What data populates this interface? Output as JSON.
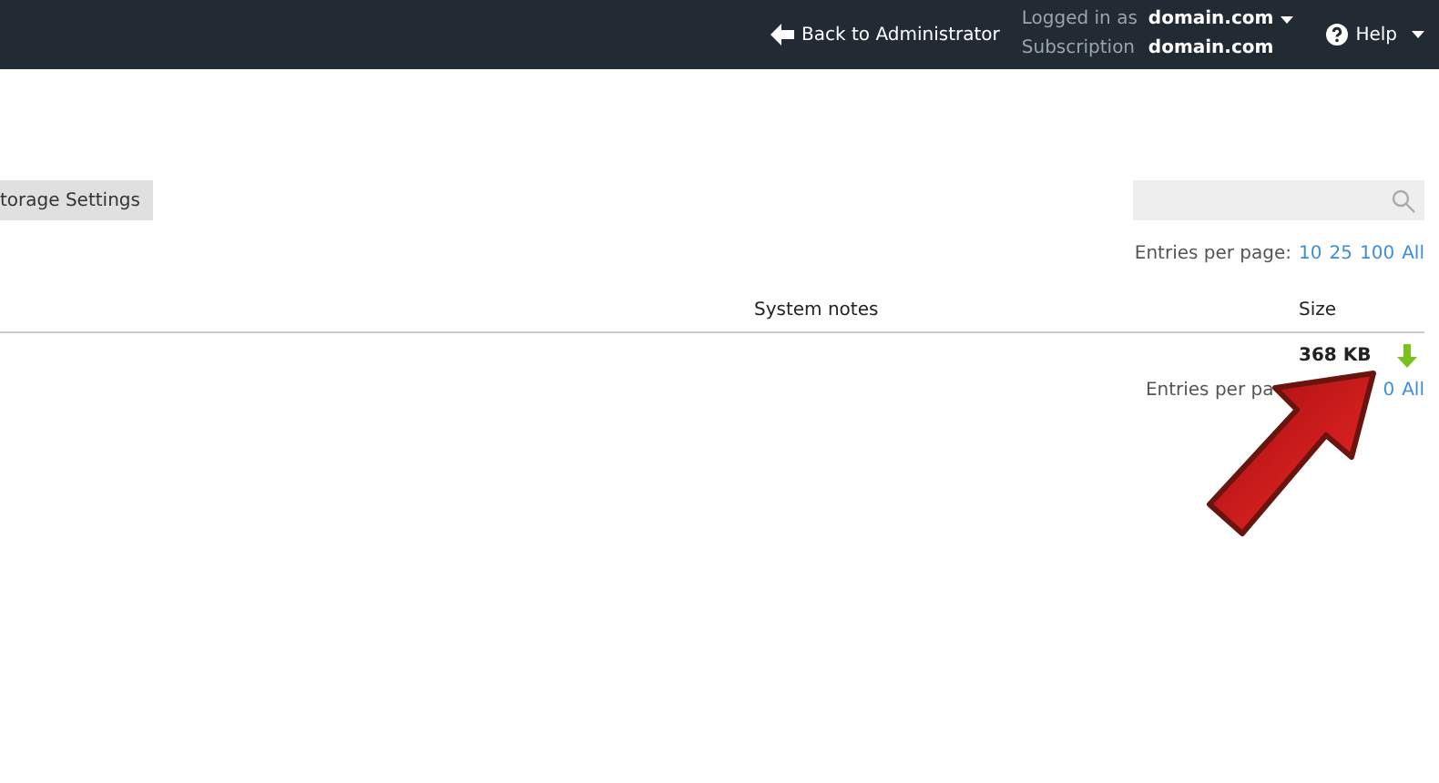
{
  "top_bar": {
    "back_link": "Back to Administrator",
    "logged_in_label": "Logged in as",
    "logged_in_value": "domain.com",
    "subscription_label": "Subscription",
    "subscription_value": "domain.com",
    "help": "Help"
  },
  "toolbar": {
    "button": "torage Settings"
  },
  "pager_top": {
    "label": "Entries per page:",
    "options": [
      {
        "label": "10"
      },
      {
        "label": "25"
      },
      {
        "label": "100"
      },
      {
        "label": "All"
      }
    ]
  },
  "table": {
    "columns": [
      "System notes",
      "Size"
    ],
    "rows": [
      {
        "size": "368 KB"
      }
    ]
  },
  "pager_bottom": {
    "label": "Entries per pa",
    "options": [
      {
        "label": "0"
      },
      {
        "label": "All"
      }
    ]
  }
}
